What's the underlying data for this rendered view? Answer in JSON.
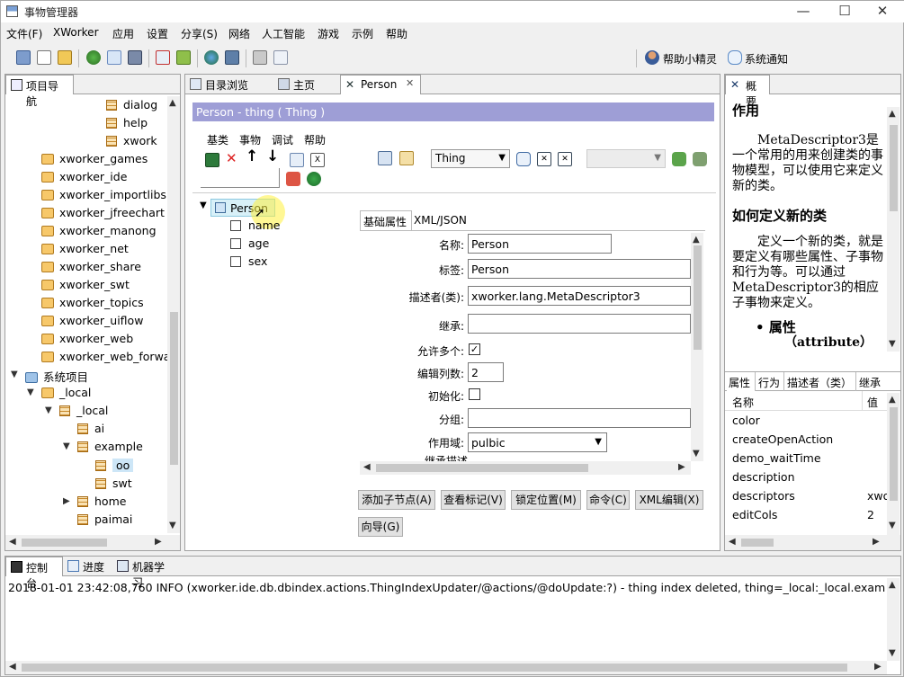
{
  "window": {
    "title": "事物管理器",
    "controls": [
      "—",
      "☐",
      "✕"
    ]
  },
  "menu": [
    "文件(F)",
    "XWorker",
    "应用",
    "设置",
    "分享(S)",
    "网络",
    "人工智能",
    "游戏",
    "示例",
    "帮助"
  ],
  "toolbar_right": {
    "helper": "帮助小精灵",
    "notify": "系统通知"
  },
  "left_panel": {
    "tab": "项目导航",
    "items": [
      {
        "label": "dialog"
      },
      {
        "label": "help"
      },
      {
        "label": "xwork"
      },
      {
        "label": "xworker_games"
      },
      {
        "label": "xworker_ide"
      },
      {
        "label": "xworker_importlibs"
      },
      {
        "label": "xworker_jfreechart"
      },
      {
        "label": "xworker_manong"
      },
      {
        "label": "xworker_net"
      },
      {
        "label": "xworker_share"
      },
      {
        "label": "xworker_swt"
      },
      {
        "label": "xworker_topics"
      },
      {
        "label": "xworker_uiflow"
      },
      {
        "label": "xworker_web"
      },
      {
        "label": "xworker_web_forwa"
      },
      {
        "label": "系统项目"
      },
      {
        "label": "_local"
      },
      {
        "label": "_local"
      },
      {
        "label": "ai"
      },
      {
        "label": "example"
      },
      {
        "label": "oo"
      },
      {
        "label": "swt"
      },
      {
        "label": "home"
      },
      {
        "label": "paimai"
      }
    ]
  },
  "center_panel": {
    "tabs": [
      "目录浏览",
      "主页",
      "Person"
    ],
    "header": "Person - thing ( Thing )",
    "submenu": [
      "基类",
      "事物",
      "调试",
      "帮助"
    ],
    "thing_select": "Thing",
    "tree": {
      "root": "Person",
      "children": [
        "name",
        "age",
        "sex"
      ]
    },
    "form_tabs": [
      "基础属性",
      "XML/JSON"
    ],
    "form": {
      "name_label": "名称:",
      "name_value": "Person",
      "label_label": "标签:",
      "label_value": "Person",
      "descriptor_label": "描述者(类):",
      "descriptor_value": "xworker.lang.MetaDescriptor3",
      "extends_label": "继承:",
      "extends_value": "",
      "many_label": "允许多个:",
      "many_checked": "✓",
      "cols_label": "编辑列数:",
      "cols_value": "2",
      "init_label": "初始化:",
      "group_label": "分组:",
      "group_value": "",
      "scope_label": "作用域:",
      "scope_value": "pulbic",
      "cut_label": "继承描述"
    },
    "buttons": [
      "添加子节点(A)",
      "查看标记(V)",
      "锁定位置(M)",
      "命令(C)",
      "XML编辑(X)",
      "向导(G)"
    ]
  },
  "right_panel": {
    "tab": "概要",
    "heading1": "作用",
    "para1": "MetaDescriptor3是一个常用的用来创建类的事物模型，可以使用它来定义新的类。",
    "heading2": "如何定义新的类",
    "para2": "定义一个新的类，就是要定义有哪些属性、子事物和行为等。可以通过MetaDescriptor3的相应子事物来定义。",
    "bullet": "属性",
    "bullet_sub": "（attribute）",
    "prop_tabs": [
      "属性",
      "行为",
      "描述者（类）",
      "继承"
    ],
    "prop_header": {
      "name": "名称",
      "value": "值"
    },
    "props": [
      {
        "name": "color",
        "value": ""
      },
      {
        "name": "createOpenAction",
        "value": ""
      },
      {
        "name": "demo_waitTime",
        "value": ""
      },
      {
        "name": "description",
        "value": ""
      },
      {
        "name": "descriptors",
        "value": "xwo"
      },
      {
        "name": "editCols",
        "value": "2"
      }
    ]
  },
  "bottom_panel": {
    "tabs": [
      "控制台",
      "进度",
      "机器学习"
    ],
    "log": "2018-01-01 23:42:08,760  INFO (xworker.ide.db.dbindex.actions.ThingIndexUpdater/@actions/@doUpdate:?) - thing index deleted, thing=_local:_local.example.oo.Zhang"
  }
}
